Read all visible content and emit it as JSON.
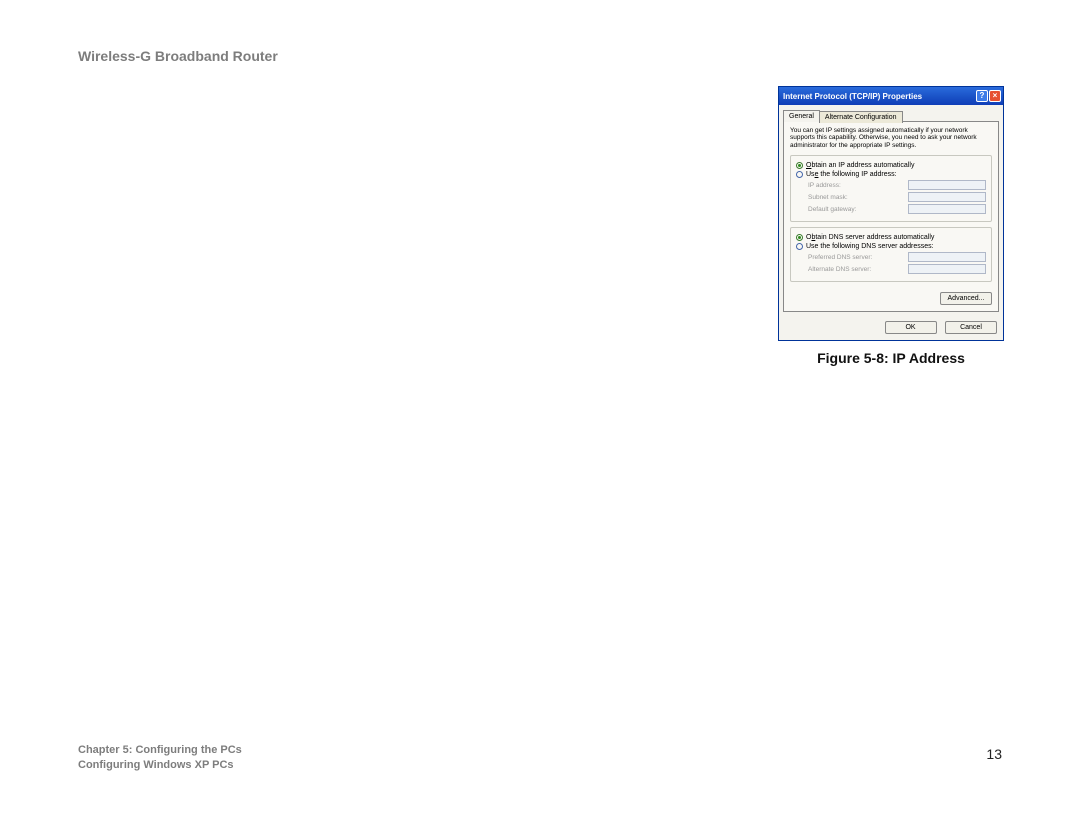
{
  "header": {
    "title": "Wireless-G Broadband Router"
  },
  "footer": {
    "chapter": "Chapter 5: Configuring the PCs",
    "section": "Configuring Windows XP PCs",
    "page_number": "13"
  },
  "figure": {
    "caption": "Figure 5-8: IP Address"
  },
  "dialog": {
    "title": "Internet Protocol (TCP/IP) Properties",
    "help_icon": "?",
    "close_icon": "×",
    "tabs": {
      "general": "General",
      "alt": "Alternate Configuration"
    },
    "description": "You can get IP settings assigned automatically if your network supports this capability. Otherwise, you need to ask your network administrator for the appropriate IP settings.",
    "radio_obtain_ip_prefix": "O",
    "radio_obtain_ip_rest": "btain an IP address automatically",
    "radio_use_ip_prefix": "Us",
    "radio_use_ip_underline": "e",
    "radio_use_ip_rest": " the following IP address:",
    "label_ip": "IP address:",
    "label_subnet": "Subnet mask:",
    "label_gateway": "Default gateway:",
    "radio_obtain_dns_prefix": "O",
    "radio_obtain_dns_underline": "b",
    "radio_obtain_dns_rest": "tain DNS server address automatically",
    "radio_use_dns": "Use the following DNS server addresses:",
    "label_pref_dns": "Preferred DNS server:",
    "label_alt_dns": "Alternate DNS server:",
    "btn_advanced": "Advanced...",
    "btn_ok": "OK",
    "btn_cancel": "Cancel"
  }
}
